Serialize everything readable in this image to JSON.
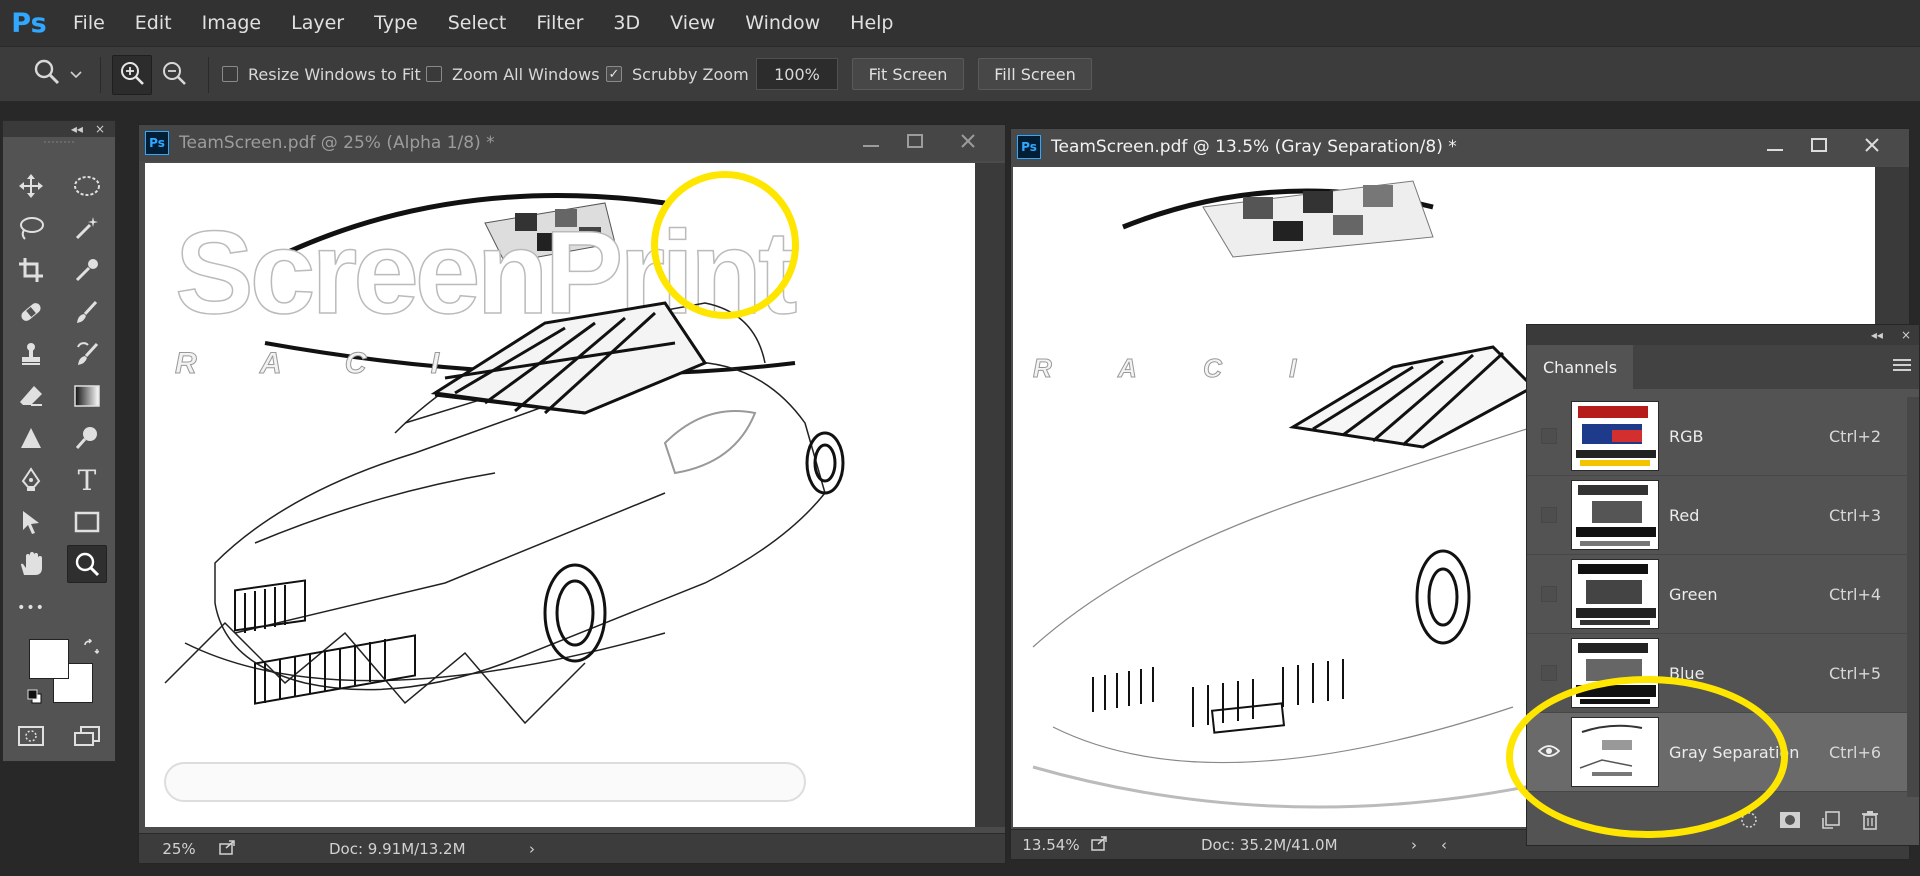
{
  "app": {
    "logo": "Ps"
  },
  "menu": [
    "File",
    "Edit",
    "Image",
    "Layer",
    "Type",
    "Select",
    "Filter",
    "3D",
    "View",
    "Window",
    "Help"
  ],
  "options": {
    "resize_windows": {
      "label": "Resize Windows to Fit",
      "checked": false
    },
    "zoom_all": {
      "label": "Zoom All Windows",
      "checked": false
    },
    "scrubby": {
      "label": "Scrubby Zoom",
      "checked": true
    },
    "zoom_value": "100%",
    "fit_screen": "Fit Screen",
    "fill_screen": "Fill Screen"
  },
  "toolbar": {
    "collapse_glyph": "◂◂",
    "close_glyph": "×",
    "tools": [
      "move",
      "marquee",
      "lasso",
      "magic-wand",
      "crop",
      "eyedropper",
      "healing",
      "brush",
      "stamp",
      "history-brush",
      "eraser",
      "gradient",
      "sharpen",
      "dodge",
      "pen",
      "type",
      "path-select",
      "rectangle",
      "hand",
      "zoom"
    ],
    "type_glyph": "T",
    "more_glyph": "•••"
  },
  "doc_left": {
    "title": "TeamScreen.pdf @ 25% (Alpha 1/8) *",
    "zoom": "25%",
    "doc_info": "Doc: 9.91M/13.2M",
    "art_title": "ScreenPrint",
    "art_sub": "R A C I"
  },
  "doc_right": {
    "title": "TeamScreen.pdf @ 13.5% (Gray Separation/8) *",
    "zoom": "13.54%",
    "doc_info": "Doc: 35.2M/41.0M",
    "art_sub": "R A C I"
  },
  "channels": {
    "collapse_glyph": "◂◂",
    "close_glyph": "×",
    "tab": "Channels",
    "rows": [
      {
        "name": "RGB",
        "shortcut": "Ctrl+2",
        "visible": false
      },
      {
        "name": "Red",
        "shortcut": "Ctrl+3",
        "visible": false
      },
      {
        "name": "Green",
        "shortcut": "Ctrl+4",
        "visible": false
      },
      {
        "name": "Blue",
        "shortcut": "Ctrl+5",
        "visible": false
      },
      {
        "name": "Gray Separation",
        "shortcut": "Ctrl+6",
        "visible": true
      }
    ]
  },
  "colors": {
    "highlight": "#ffe600",
    "brand": "#31a8ff"
  }
}
